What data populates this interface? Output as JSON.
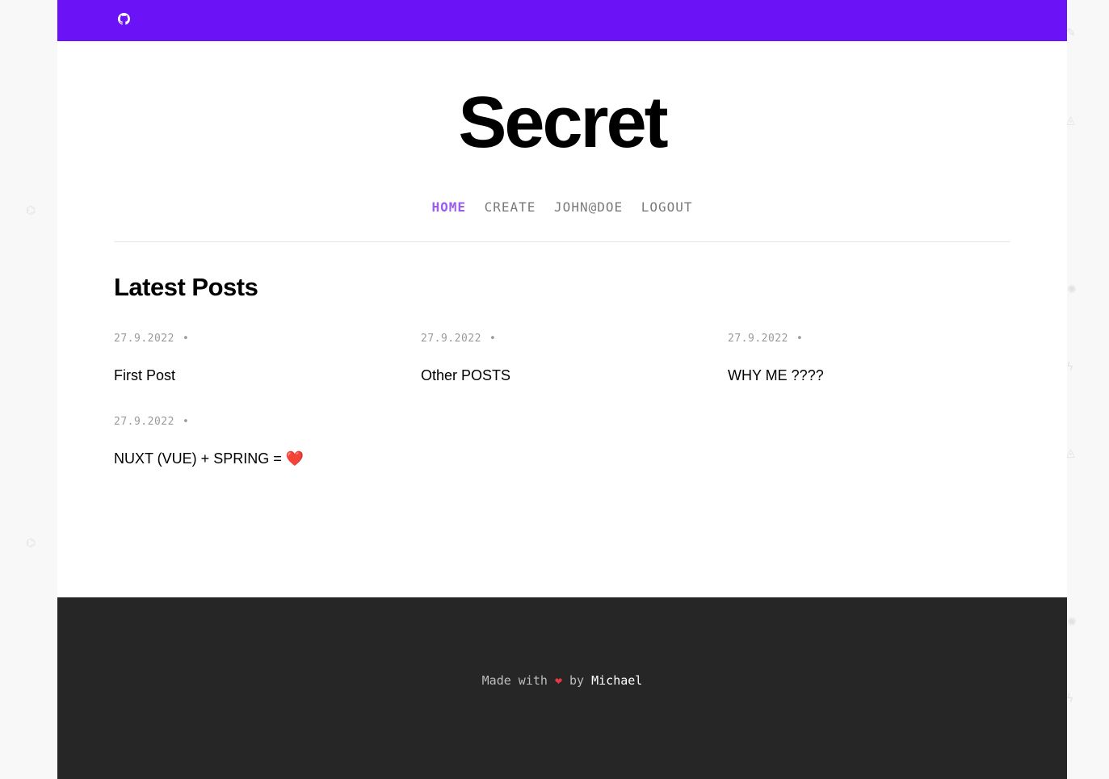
{
  "site": {
    "title": "Secret"
  },
  "nav": {
    "items": [
      {
        "label": "HOME",
        "active": true
      },
      {
        "label": "CREATE",
        "active": false
      },
      {
        "label": "JOHN@DOE",
        "active": false
      },
      {
        "label": "LOGOUT",
        "active": false
      }
    ]
  },
  "main": {
    "section_title": "Latest Posts",
    "posts": [
      {
        "date": "27.9.2022",
        "separator": "•",
        "title": "First Post"
      },
      {
        "date": "27.9.2022",
        "separator": "•",
        "title": "Other POSTS"
      },
      {
        "date": "27.9.2022",
        "separator": "•",
        "title": "WHY ME ????"
      },
      {
        "date": "27.9.2022",
        "separator": "•",
        "title": "NUXT (VUE) + SPRING = ",
        "emoji": "❤️"
      }
    ]
  },
  "footer": {
    "made_with": "Made with",
    "heart": "❤",
    "by": "by",
    "author": "Michael"
  },
  "colors": {
    "topbar": "#6c12f7",
    "nav_active": "#9b5cf1",
    "footer_bg": "#262626"
  },
  "icons": {
    "topbar": "github-icon"
  }
}
